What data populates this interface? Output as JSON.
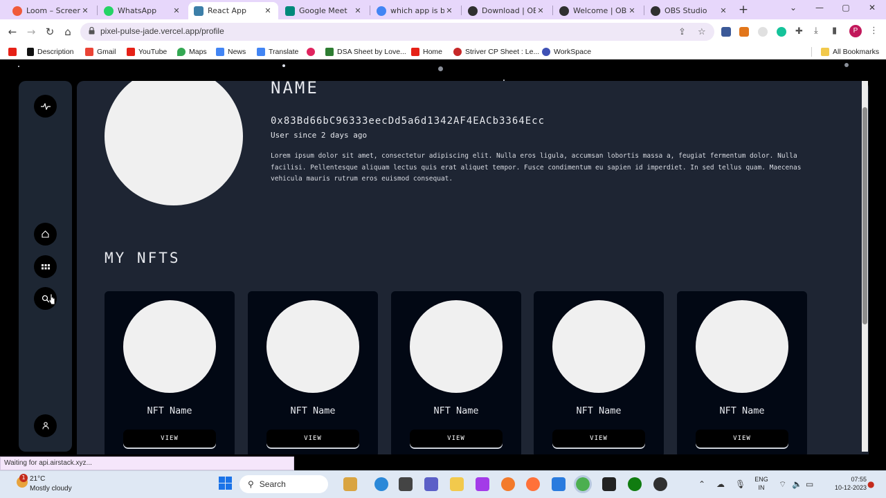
{
  "browser": {
    "tabs": [
      {
        "title": "Loom – Screen R",
        "favicon_color": "#f05a3a",
        "active": false
      },
      {
        "title": "WhatsApp",
        "favicon_color": "#25d366",
        "active": false
      },
      {
        "title": "React App",
        "favicon_color": "#3c7fa8",
        "active": true
      },
      {
        "title": "Google Meet",
        "favicon_color": "#00897b",
        "active": false
      },
      {
        "title": "which app is be",
        "favicon_color": "#4285f4",
        "active": false
      },
      {
        "title": "Download | OBS",
        "favicon_color": "#303030",
        "active": false
      },
      {
        "title": "Welcome | OBS",
        "favicon_color": "#303030",
        "active": false
      },
      {
        "title": "OBS Studio",
        "favicon_color": "#303030",
        "active": false
      }
    ],
    "tab_close_glyph": "✕",
    "new_tab_glyph": "+",
    "url": "pixel-pulse-jade.vercel.app/profile",
    "bookmarks": [
      {
        "label": "",
        "color": "#e62117"
      },
      {
        "label": "Description",
        "color": "#111111"
      },
      {
        "label": "Gmail",
        "color": "#ea4335"
      },
      {
        "label": "YouTube",
        "color": "#e62117"
      },
      {
        "label": "Maps",
        "color": "#34a853"
      },
      {
        "label": "News",
        "color": "#4285f4"
      },
      {
        "label": "Translate",
        "color": "#4285f4"
      },
      {
        "label": "",
        "color": "#e0245e"
      },
      {
        "label": "DSA Sheet by Love...",
        "color": "#2e7d32"
      },
      {
        "label": "Home",
        "color": "#e62117"
      },
      {
        "label": "Striver CP Sheet : Le...",
        "color": "#c62828"
      },
      {
        "label": "WorkSpace",
        "color": "#3f51b5"
      }
    ],
    "all_bookmarks_label": "All Bookmarks",
    "profile_initial": "P",
    "status_text": "Waiting for api.airstack.xyz..."
  },
  "sidebar": {
    "top_icon": "activity-pulse-icon",
    "items": [
      {
        "name": "home",
        "icon": "home-icon",
        "glyph": "⌂"
      },
      {
        "name": "marketplace",
        "icon": "grid-icon",
        "glyph": "▪▪"
      },
      {
        "name": "search",
        "icon": "search-icon",
        "glyph": "⚲"
      }
    ],
    "bottom_icon": "user-icon"
  },
  "profile": {
    "name": "NAME",
    "wallet": "0x83Bd66bC96333eecDd5a6d1342AF4EACb3364Ecc",
    "since": "User since 2 days ago",
    "bio": "Lorem ipsum dolor sit amet, consectetur adipiscing elit. Nulla eros ligula, accumsan lobortis massa a, feugiat fermentum dolor. Nulla facilisi. Pellentesque aliquam lectus quis erat aliquet tempor. Fusce condimentum eu sapien id imperdiet. In sed tellus quam. Maecenas vehicula mauris rutrum eros euismod consequat."
  },
  "nfts": {
    "section_title": "MY NFTS",
    "items": [
      {
        "name": "NFT Name",
        "button": "VIEW"
      },
      {
        "name": "NFT Name",
        "button": "VIEW"
      },
      {
        "name": "NFT Name",
        "button": "VIEW"
      },
      {
        "name": "NFT Name",
        "button": "VIEW"
      },
      {
        "name": "NFT Name",
        "button": "VIEW"
      }
    ]
  },
  "taskbar": {
    "weather_temp": "21°C",
    "weather_desc": "Mostly cloudy",
    "weather_badge": "1",
    "search_label": "Search",
    "lang_line1": "ENG",
    "lang_line2": "IN",
    "time": "07:55",
    "date": "10-12-2023"
  },
  "colors": {
    "accent": "#e7d7fb",
    "page_background": "#000000",
    "panel": "#1e2533",
    "card": "#020814"
  }
}
